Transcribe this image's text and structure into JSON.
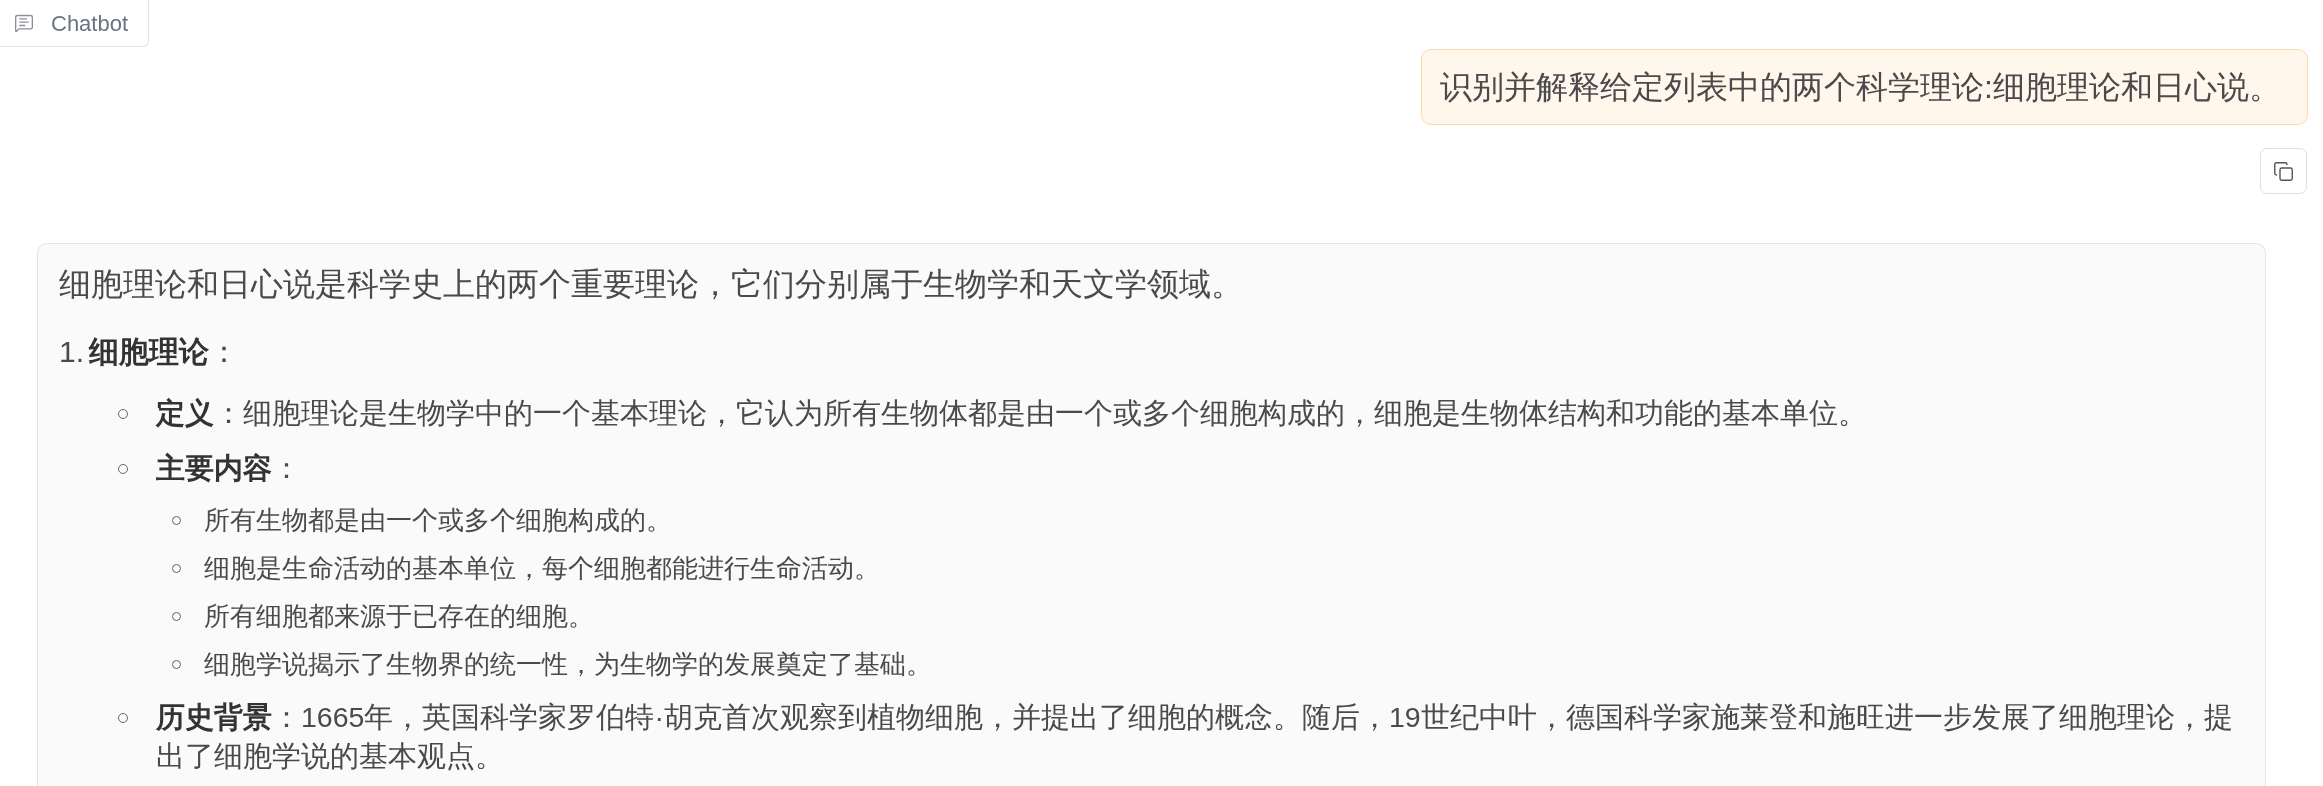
{
  "header": {
    "label": "Chatbot"
  },
  "user_message": {
    "text": "识别并解释给定列表中的两个科学理论:细胞理论和日心说。"
  },
  "bot_message": {
    "intro": "细胞理论和日心说是科学史上的两个重要理论，它们分别属于生物学和天文学领域。",
    "sections": [
      {
        "marker": "1.",
        "title": "**细胞理论**：",
        "items": [
          {
            "text": "**定义**：细胞理论是生物学中的一个基本理论，它认为所有生物体都是由一个或多个细胞构成的，细胞是生物体结构和功能的基本单位。"
          },
          {
            "text": "**主要内容**：",
            "children": [
              {
                "text": "所有生物都是由一个或多个细胞构成的。"
              },
              {
                "text": "细胞是生命活动的基本单位，每个细胞都能进行生命活动。"
              },
              {
                "text": "所有细胞都来源于已存在的细胞。"
              },
              {
                "text": "细胞学说揭示了生物界的统一性，为生物学的发展奠定了基础。"
              }
            ]
          },
          {
            "text": "**历史背景**：1665年，英国科学家罗伯特·胡克首次观察到植物细胞，并提出了细胞的概念。随后，19世纪中叶，德国科学家施莱登和施旺进一步发展了细胞理论，提出了细胞学说的基本观点。"
          }
        ]
      }
    ]
  }
}
